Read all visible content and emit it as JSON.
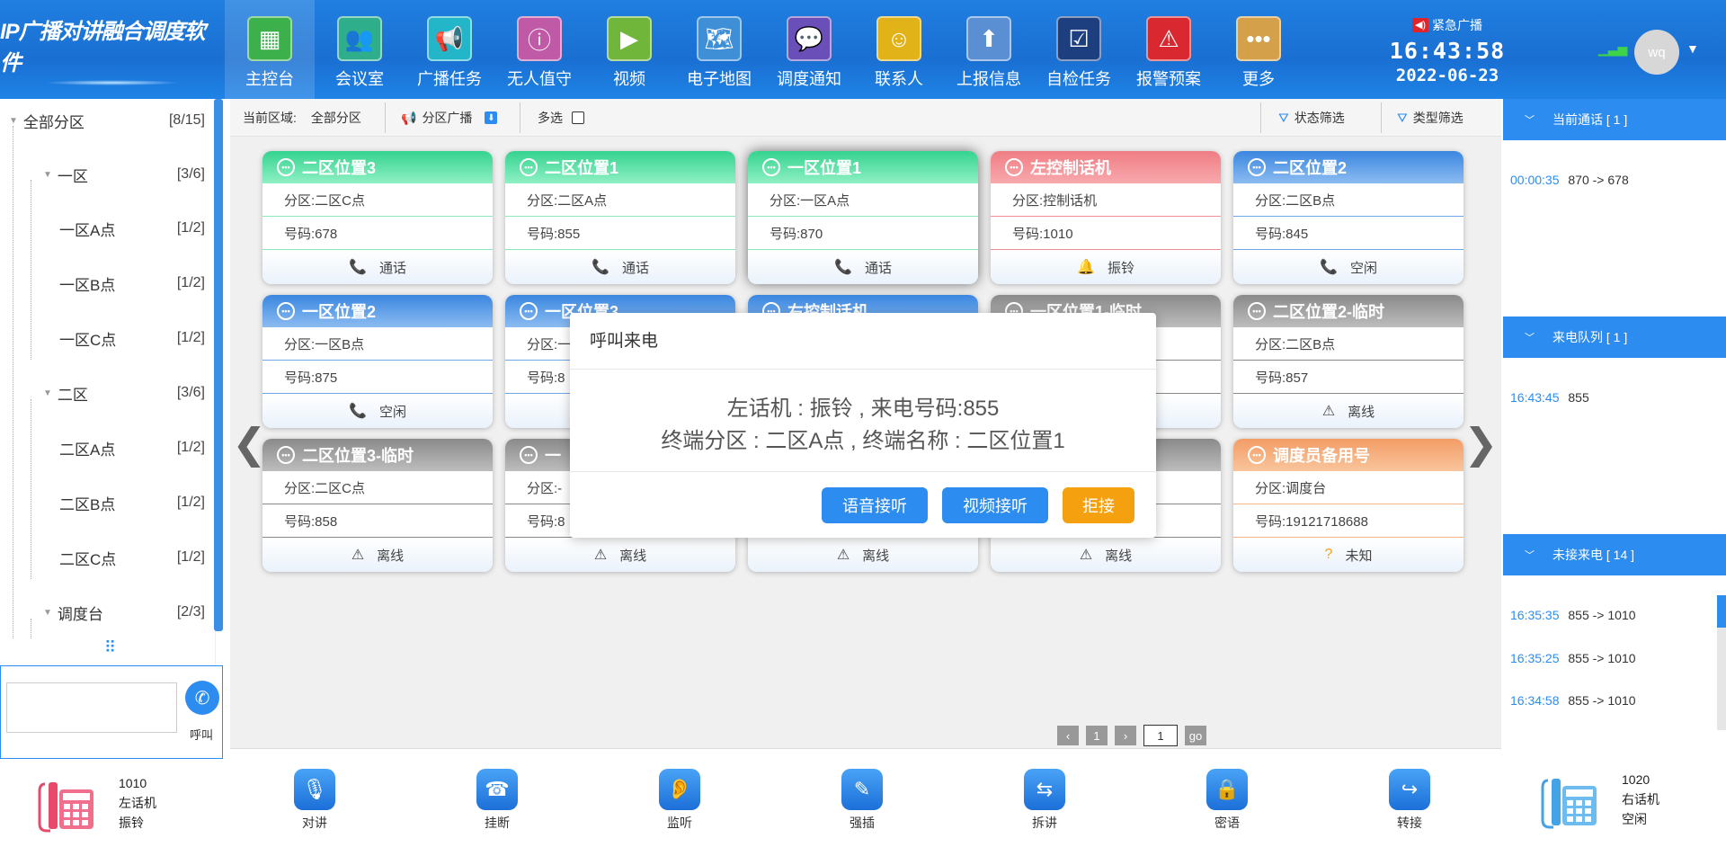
{
  "app": {
    "title": "IP广播对讲融合调度软件"
  },
  "nav": [
    {
      "label": "主控台",
      "icon": "dashboard-icon",
      "color": "#3cb04a"
    },
    {
      "label": "会议室",
      "icon": "meeting-icon",
      "color": "#2fae8c"
    },
    {
      "label": "广播任务",
      "icon": "megaphone-icon",
      "color": "#22b6c8"
    },
    {
      "label": "无人值守",
      "icon": "unattended-icon",
      "color": "#c05aa6"
    },
    {
      "label": "视频",
      "icon": "video-icon",
      "color": "#6fb63a"
    },
    {
      "label": "电子地图",
      "icon": "map-icon",
      "color": "#3f8fd6"
    },
    {
      "label": "调度通知",
      "icon": "notice-icon",
      "color": "#6a4fb8"
    },
    {
      "label": "联系人",
      "icon": "contacts-icon",
      "color": "#e2b219"
    },
    {
      "label": "上报信息",
      "icon": "report-icon",
      "color": "#5b8fd4"
    },
    {
      "label": "自检任务",
      "icon": "checklist-icon",
      "color": "#1d3f7f"
    },
    {
      "label": "报警预案",
      "icon": "alarm-icon",
      "color": "#d9282f"
    },
    {
      "label": "更多",
      "icon": "more-icon",
      "color": "#d5a04a"
    }
  ],
  "header": {
    "emergency": "紧急广播",
    "time": "16:43:58",
    "date": "2022-06-23",
    "user": "wq"
  },
  "tree": [
    {
      "label": "全部分区",
      "count": "[8/15]"
    },
    {
      "label": "一区",
      "count": "[3/6]"
    },
    {
      "label": "一区A点",
      "count": "[1/2]"
    },
    {
      "label": "一区B点",
      "count": "[1/2]"
    },
    {
      "label": "一区C点",
      "count": "[1/2]"
    },
    {
      "label": "二区",
      "count": "[3/6]"
    },
    {
      "label": "二区A点",
      "count": "[1/2]"
    },
    {
      "label": "二区B点",
      "count": "[1/2]"
    },
    {
      "label": "二区C点",
      "count": "[1/2]"
    },
    {
      "label": "调度台",
      "count": "[2/3]"
    }
  ],
  "call": {
    "label": "呼叫",
    "value": ""
  },
  "left_phone": {
    "number": "1010",
    "name": "左话机",
    "status": "振铃"
  },
  "right_phone": {
    "number": "1020",
    "name": "右话机",
    "status": "空闲"
  },
  "filter": {
    "area_label": "当前区域:",
    "area_value": "全部分区",
    "broadcast": "分区广播",
    "multi": "多选",
    "status_filter": "状态筛选",
    "type_filter": "类型筛选"
  },
  "cards": [
    {
      "title": "二区位置3",
      "zone": "分区:二区C点",
      "num": "号码:678",
      "status": "通话",
      "color": "green",
      "sicon": "📞"
    },
    {
      "title": "二区位置1",
      "zone": "分区:二区A点",
      "num": "号码:855",
      "status": "通话",
      "color": "green",
      "sicon": "📞"
    },
    {
      "title": "一区位置1",
      "zone": "分区:一区A点",
      "num": "号码:870",
      "status": "通话",
      "color": "green",
      "sicon": "📞"
    },
    {
      "title": "左控制话机",
      "zone": "分区:控制话机",
      "num": "号码:1010",
      "status": "振铃",
      "color": "pink",
      "sicon": "🔔"
    },
    {
      "title": "二区位置2",
      "zone": "分区:二区B点",
      "num": "号码:845",
      "status": "空闲",
      "color": "blue",
      "sicon": "📞"
    },
    {
      "title": "一区位置2",
      "zone": "分区:一区B点",
      "num": "号码:875",
      "status": "空闲",
      "color": "blue",
      "sicon": "📞"
    },
    {
      "title": "一区位置3",
      "zone": "分区:一",
      "num": "号码:8",
      "status": "",
      "color": "blue",
      "sicon": ""
    },
    {
      "title": "右控制话机",
      "zone": "",
      "num": "",
      "status": "",
      "color": "blue",
      "sicon": ""
    },
    {
      "title": "一区位置1-临时",
      "zone": "",
      "num": "",
      "status": "",
      "color": "gray",
      "sicon": ""
    },
    {
      "title": "二区位置2-临时",
      "zone": "分区:二区B点",
      "num": "号码:857",
      "status": "离线",
      "color": "gray",
      "sicon": "⚠"
    },
    {
      "title": "二区位置3-临时",
      "zone": "分区:二区C点",
      "num": "号码:858",
      "status": "离线",
      "color": "gray",
      "sicon": "⚠"
    },
    {
      "title": "一",
      "zone": "分区:-",
      "num": "号码:8",
      "status": "离线",
      "color": "gray",
      "sicon": "⚠"
    },
    {
      "title": "",
      "zone": "",
      "num": "",
      "status": "离线",
      "color": "gray",
      "sicon": "⚠"
    },
    {
      "title": "",
      "zone": "",
      "num": "",
      "status": "离线",
      "color": "gray",
      "sicon": "⚠"
    },
    {
      "title": "调度员备用号",
      "zone": "分区:调度台",
      "num": "号码:19121718688",
      "status": "未知",
      "color": "orange",
      "sicon": "?"
    }
  ],
  "pager": {
    "page": "1",
    "input": "1",
    "go": "go"
  },
  "tools": [
    {
      "label": "对讲",
      "icon": "intercom-icon"
    },
    {
      "label": "挂断",
      "icon": "hangup-icon"
    },
    {
      "label": "监听",
      "icon": "listen-icon"
    },
    {
      "label": "强插",
      "icon": "force-insert-icon"
    },
    {
      "label": "拆讲",
      "icon": "split-icon"
    },
    {
      "label": "密语",
      "icon": "lock-icon"
    },
    {
      "label": "转接",
      "icon": "transfer-icon"
    }
  ],
  "right": {
    "current_header": "当前通话 [ 1 ]",
    "current": [
      {
        "time": "00:00:35",
        "text": "870 -> 678"
      }
    ],
    "queue_header": "来电队列 [ 1 ]",
    "queue": [
      {
        "time": "16:43:45",
        "text": "855"
      }
    ],
    "missed_header": "未接来电 [ 14 ]",
    "missed": [
      {
        "time": "16:35:35",
        "text": "855 -> 1010"
      },
      {
        "time": "16:35:25",
        "text": "855 -> 1010"
      },
      {
        "time": "16:34:58",
        "text": "855 -> 1010"
      }
    ]
  },
  "modal": {
    "title": "呼叫来电",
    "line1": "左话机 : 振铃 , 来电号码:855",
    "line2": "终端分区 : 二区A点 , 终端名称 : 二区位置1",
    "voice": "语音接听",
    "video": "视频接听",
    "reject": "拒接"
  },
  "colors": {
    "accent": "#2d8cf0",
    "reject": "#f5a10f",
    "ringing": "#ef7d84"
  }
}
